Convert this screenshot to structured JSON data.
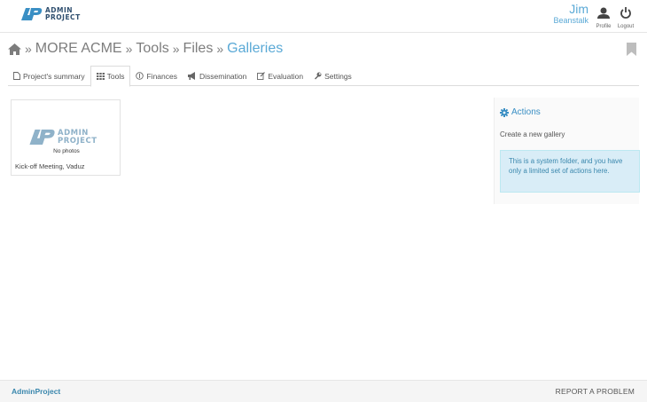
{
  "header": {
    "logo": {
      "line1": "ADMIN",
      "line2": "PROJECT"
    },
    "user": {
      "first_name": "Jim",
      "last_name": "Beanstalk"
    },
    "profile_label": "Profile",
    "logout_label": "Logout"
  },
  "breadcrumb": {
    "separator": "»",
    "items": [
      "MORE ACME",
      "Tools",
      "Files"
    ],
    "current": "Galleries"
  },
  "tabs": [
    {
      "label": "Project's summary",
      "icon": "file-icon"
    },
    {
      "label": "Tools",
      "icon": "grid-icon",
      "active": true
    },
    {
      "label": "Finances",
      "icon": "coin-icon"
    },
    {
      "label": "Dissemination",
      "icon": "megaphone-icon"
    },
    {
      "label": "Evaluation",
      "icon": "edit-icon"
    },
    {
      "label": "Settings",
      "icon": "wrench-icon"
    }
  ],
  "gallery": {
    "logo": {
      "line1": "ADMIN",
      "line2": "PROJECT"
    },
    "no_photos": "No photos",
    "caption": "Kick-off Meeting, Vaduz"
  },
  "actions": {
    "title": "Actions",
    "create_link": "Create a new gallery",
    "info": "This is a system folder, and you have only a limited set of actions here."
  },
  "footer": {
    "brand": "AdminProject",
    "report": "REPORT A PROBLEM"
  },
  "colors": {
    "accent": "#5aa9d6",
    "link": "#3a87ad",
    "info_bg": "#d9edf7"
  }
}
